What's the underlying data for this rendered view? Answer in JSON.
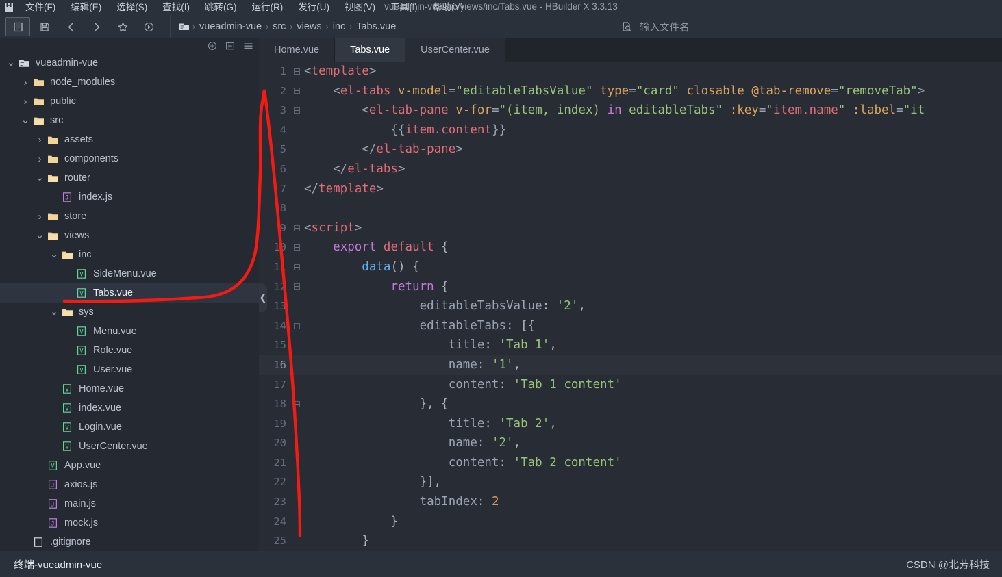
{
  "window": {
    "title": "vueadmin-vue/src/views/inc/Tabs.vue - HBuilder X 3.3.13",
    "logo_icon": "hbuilder-logo-icon"
  },
  "menubar": {
    "items": [
      {
        "label": "文件(F)",
        "name": "menu-file"
      },
      {
        "label": "编辑(E)",
        "name": "menu-edit"
      },
      {
        "label": "选择(S)",
        "name": "menu-select"
      },
      {
        "label": "查找(I)",
        "name": "menu-find"
      },
      {
        "label": "跳转(G)",
        "name": "menu-goto"
      },
      {
        "label": "运行(R)",
        "name": "menu-run"
      },
      {
        "label": "发行(U)",
        "name": "menu-publish"
      },
      {
        "label": "视图(V)",
        "name": "menu-view"
      },
      {
        "label": "工具(I)",
        "name": "menu-tools"
      },
      {
        "label": "帮助(Y)",
        "name": "menu-help"
      }
    ]
  },
  "toolbar": {
    "buttons": [
      {
        "icon": "new-file-icon",
        "active": true
      },
      {
        "icon": "save-icon",
        "active": false
      },
      {
        "icon": "back-icon",
        "active": false
      },
      {
        "icon": "forward-icon",
        "active": false
      },
      {
        "icon": "star-icon",
        "active": false
      },
      {
        "icon": "run-icon",
        "active": false
      }
    ],
    "breadcrumb": {
      "icon": "project-folder-icon",
      "separator": "›",
      "items": [
        "vueadmin-vue",
        "src",
        "views",
        "inc",
        "Tabs.vue"
      ]
    },
    "search": {
      "icon": "file-search-icon",
      "placeholder": "输入文件名",
      "value": ""
    }
  },
  "sidebar": {
    "header_icons": [
      "add-icon",
      "collapse-all-icon",
      "menu-icon"
    ],
    "tree": [
      {
        "label": "vueadmin-vue",
        "depth": 0,
        "icon": "project-icon",
        "twisty": "open",
        "selected": false
      },
      {
        "label": "node_modules",
        "depth": 1,
        "icon": "folder-icon",
        "twisty": "closed",
        "selected": false
      },
      {
        "label": "public",
        "depth": 1,
        "icon": "folder-icon",
        "twisty": "closed",
        "selected": false
      },
      {
        "label": "src",
        "depth": 1,
        "icon": "folder-open-icon",
        "twisty": "open",
        "selected": false
      },
      {
        "label": "assets",
        "depth": 2,
        "icon": "folder-icon",
        "twisty": "closed",
        "selected": false
      },
      {
        "label": "components",
        "depth": 2,
        "icon": "folder-icon",
        "twisty": "closed",
        "selected": false
      },
      {
        "label": "router",
        "depth": 2,
        "icon": "folder-open-icon",
        "twisty": "open",
        "selected": false
      },
      {
        "label": "index.js",
        "depth": 3,
        "icon": "js-file-icon",
        "twisty": "none",
        "selected": false
      },
      {
        "label": "store",
        "depth": 2,
        "icon": "folder-icon",
        "twisty": "closed",
        "selected": false
      },
      {
        "label": "views",
        "depth": 2,
        "icon": "folder-open-icon",
        "twisty": "open",
        "selected": false
      },
      {
        "label": "inc",
        "depth": 3,
        "icon": "folder-open-icon",
        "twisty": "open",
        "selected": false
      },
      {
        "label": "SideMenu.vue",
        "depth": 4,
        "icon": "vue-file-icon",
        "twisty": "none",
        "selected": false
      },
      {
        "label": "Tabs.vue",
        "depth": 4,
        "icon": "vue-file-icon",
        "twisty": "none",
        "selected": true
      },
      {
        "label": "sys",
        "depth": 3,
        "icon": "folder-open-icon",
        "twisty": "open",
        "selected": false
      },
      {
        "label": "Menu.vue",
        "depth": 4,
        "icon": "vue-file-icon",
        "twisty": "none",
        "selected": false
      },
      {
        "label": "Role.vue",
        "depth": 4,
        "icon": "vue-file-icon",
        "twisty": "none",
        "selected": false
      },
      {
        "label": "User.vue",
        "depth": 4,
        "icon": "vue-file-icon",
        "twisty": "none",
        "selected": false
      },
      {
        "label": "Home.vue",
        "depth": 3,
        "icon": "vue-file-icon",
        "twisty": "none",
        "selected": false
      },
      {
        "label": "index.vue",
        "depth": 3,
        "icon": "vue-file-icon",
        "twisty": "none",
        "selected": false
      },
      {
        "label": "Login.vue",
        "depth": 3,
        "icon": "vue-file-icon",
        "twisty": "none",
        "selected": false
      },
      {
        "label": "UserCenter.vue",
        "depth": 3,
        "icon": "vue-file-icon",
        "twisty": "none",
        "selected": false
      },
      {
        "label": "App.vue",
        "depth": 2,
        "icon": "vue-file-icon",
        "twisty": "none",
        "selected": false
      },
      {
        "label": "axios.js",
        "depth": 2,
        "icon": "js-file-icon",
        "twisty": "none",
        "selected": false
      },
      {
        "label": "main.js",
        "depth": 2,
        "icon": "js-file-icon",
        "twisty": "none",
        "selected": false
      },
      {
        "label": "mock.js",
        "depth": 2,
        "icon": "js-file-icon",
        "twisty": "none",
        "selected": false
      },
      {
        "label": ".gitignore",
        "depth": 1,
        "icon": "plain-file-icon",
        "twisty": "none",
        "selected": false
      }
    ]
  },
  "editor": {
    "tabs": [
      {
        "label": "Home.vue",
        "active": false
      },
      {
        "label": "Tabs.vue",
        "active": true
      },
      {
        "label": "UserCenter.vue",
        "active": false
      }
    ],
    "collapse_handle_icon": "chevron-left-icon",
    "current_line": 16,
    "lines": [
      {
        "n": 1,
        "fold": true,
        "tokens": [
          {
            "t": "<",
            "c": "punct"
          },
          {
            "t": "template",
            "c": "tag"
          },
          {
            "t": ">",
            "c": "punct"
          }
        ]
      },
      {
        "n": 2,
        "fold": true,
        "tokens": [
          {
            "t": "    <",
            "c": "punct"
          },
          {
            "t": "el-tabs",
            "c": "tag"
          },
          {
            "t": " ",
            "c": "plain"
          },
          {
            "t": "v-model",
            "c": "attr"
          },
          {
            "t": "=",
            "c": "punct"
          },
          {
            "t": "\"editableTabsValue\"",
            "c": "str"
          },
          {
            "t": " ",
            "c": "plain"
          },
          {
            "t": "type",
            "c": "attr"
          },
          {
            "t": "=",
            "c": "punct"
          },
          {
            "t": "\"card\"",
            "c": "str"
          },
          {
            "t": " ",
            "c": "plain"
          },
          {
            "t": "closable",
            "c": "attr"
          },
          {
            "t": " ",
            "c": "plain"
          },
          {
            "t": "@tab-remove",
            "c": "attr"
          },
          {
            "t": "=",
            "c": "punct"
          },
          {
            "t": "\"removeTab\"",
            "c": "str"
          },
          {
            "t": ">",
            "c": "punct"
          }
        ]
      },
      {
        "n": 3,
        "fold": true,
        "tokens": [
          {
            "t": "        <",
            "c": "punct"
          },
          {
            "t": "el-tab-pane",
            "c": "tag"
          },
          {
            "t": " ",
            "c": "plain"
          },
          {
            "t": "v-for",
            "c": "attr"
          },
          {
            "t": "=",
            "c": "punct"
          },
          {
            "t": "\"(item, index) ",
            "c": "str"
          },
          {
            "t": "in",
            "c": "kw"
          },
          {
            "t": " editableTabs\"",
            "c": "str"
          },
          {
            "t": " ",
            "c": "plain"
          },
          {
            "t": ":key",
            "c": "attr"
          },
          {
            "t": "=",
            "c": "punct"
          },
          {
            "t": "\"",
            "c": "str"
          },
          {
            "t": "item.name",
            "c": "tag"
          },
          {
            "t": "\"",
            "c": "str"
          },
          {
            "t": " ",
            "c": "plain"
          },
          {
            "t": ":label",
            "c": "attr"
          },
          {
            "t": "=",
            "c": "punct"
          },
          {
            "t": "\"it",
            "c": "str"
          }
        ]
      },
      {
        "n": 4,
        "fold": false,
        "tokens": [
          {
            "t": "            {{",
            "c": "punct"
          },
          {
            "t": "item.content",
            "c": "mustache"
          },
          {
            "t": "}}",
            "c": "punct"
          }
        ]
      },
      {
        "n": 5,
        "fold": false,
        "tokens": [
          {
            "t": "        </",
            "c": "punct"
          },
          {
            "t": "el-tab-pane",
            "c": "tag"
          },
          {
            "t": ">",
            "c": "punct"
          }
        ]
      },
      {
        "n": 6,
        "fold": false,
        "tokens": [
          {
            "t": "    </",
            "c": "punct"
          },
          {
            "t": "el-tabs",
            "c": "tag"
          },
          {
            "t": ">",
            "c": "punct"
          }
        ]
      },
      {
        "n": 7,
        "fold": false,
        "tokens": [
          {
            "t": "</",
            "c": "punct"
          },
          {
            "t": "template",
            "c": "tag"
          },
          {
            "t": ">",
            "c": "punct"
          }
        ]
      },
      {
        "n": 8,
        "fold": false,
        "tokens": []
      },
      {
        "n": 9,
        "fold": true,
        "tokens": [
          {
            "t": "<",
            "c": "punct"
          },
          {
            "t": "script",
            "c": "tag"
          },
          {
            "t": ">",
            "c": "punct"
          }
        ]
      },
      {
        "n": 10,
        "fold": true,
        "tokens": [
          {
            "t": "    ",
            "c": "plain"
          },
          {
            "t": "export",
            "c": "kw"
          },
          {
            "t": " ",
            "c": "plain"
          },
          {
            "t": "default",
            "c": "tag"
          },
          {
            "t": " {",
            "c": "plain"
          }
        ]
      },
      {
        "n": 11,
        "fold": true,
        "tokens": [
          {
            "t": "        ",
            "c": "plain"
          },
          {
            "t": "data",
            "c": "fn"
          },
          {
            "t": "() {",
            "c": "plain"
          }
        ]
      },
      {
        "n": 12,
        "fold": true,
        "tokens": [
          {
            "t": "            ",
            "c": "plain"
          },
          {
            "t": "return",
            "c": "kw"
          },
          {
            "t": " {",
            "c": "plain"
          }
        ]
      },
      {
        "n": 13,
        "fold": false,
        "tokens": [
          {
            "t": "                editableTabsValue",
            "c": "prop"
          },
          {
            "t": ": ",
            "c": "plain"
          },
          {
            "t": "'2'",
            "c": "str"
          },
          {
            "t": ",",
            "c": "plain"
          }
        ]
      },
      {
        "n": 14,
        "fold": true,
        "tokens": [
          {
            "t": "                editableTabs",
            "c": "prop"
          },
          {
            "t": ": [{",
            "c": "plain"
          }
        ]
      },
      {
        "n": 15,
        "fold": false,
        "tokens": [
          {
            "t": "                    title",
            "c": "prop"
          },
          {
            "t": ": ",
            "c": "plain"
          },
          {
            "t": "'Tab 1'",
            "c": "str"
          },
          {
            "t": ",",
            "c": "plain"
          }
        ]
      },
      {
        "n": 16,
        "fold": false,
        "tokens": [
          {
            "t": "                    name",
            "c": "prop"
          },
          {
            "t": ": ",
            "c": "plain"
          },
          {
            "t": "'1'",
            "c": "str"
          },
          {
            "t": ",",
            "c": "plain"
          }
        ],
        "cursor": true
      },
      {
        "n": 17,
        "fold": false,
        "tokens": [
          {
            "t": "                    content",
            "c": "prop"
          },
          {
            "t": ": ",
            "c": "plain"
          },
          {
            "t": "'Tab 1 content'",
            "c": "str"
          }
        ]
      },
      {
        "n": 18,
        "fold": true,
        "tokens": [
          {
            "t": "                }, {",
            "c": "plain"
          }
        ]
      },
      {
        "n": 19,
        "fold": false,
        "tokens": [
          {
            "t": "                    title",
            "c": "prop"
          },
          {
            "t": ": ",
            "c": "plain"
          },
          {
            "t": "'Tab 2'",
            "c": "str"
          },
          {
            "t": ",",
            "c": "plain"
          }
        ]
      },
      {
        "n": 20,
        "fold": false,
        "tokens": [
          {
            "t": "                    name",
            "c": "prop"
          },
          {
            "t": ": ",
            "c": "plain"
          },
          {
            "t": "'2'",
            "c": "str"
          },
          {
            "t": ",",
            "c": "plain"
          }
        ]
      },
      {
        "n": 21,
        "fold": false,
        "tokens": [
          {
            "t": "                    content",
            "c": "prop"
          },
          {
            "t": ": ",
            "c": "plain"
          },
          {
            "t": "'Tab 2 content'",
            "c": "str"
          }
        ]
      },
      {
        "n": 22,
        "fold": false,
        "tokens": [
          {
            "t": "                }],",
            "c": "plain"
          }
        ]
      },
      {
        "n": 23,
        "fold": false,
        "tokens": [
          {
            "t": "                tabIndex",
            "c": "prop"
          },
          {
            "t": ": ",
            "c": "plain"
          },
          {
            "t": "2",
            "c": "num"
          }
        ]
      },
      {
        "n": 24,
        "fold": false,
        "tokens": [
          {
            "t": "            }",
            "c": "plain"
          }
        ]
      },
      {
        "n": 25,
        "fold": false,
        "tokens": [
          {
            "t": "        }",
            "c": "plain"
          }
        ]
      }
    ]
  },
  "statusbar": {
    "terminal_label": "终端-vueadmin-vue",
    "watermark": "CSDN @北芳科技"
  },
  "annotation": {
    "color": "#f51b12",
    "name": "red-highlight-curve"
  }
}
